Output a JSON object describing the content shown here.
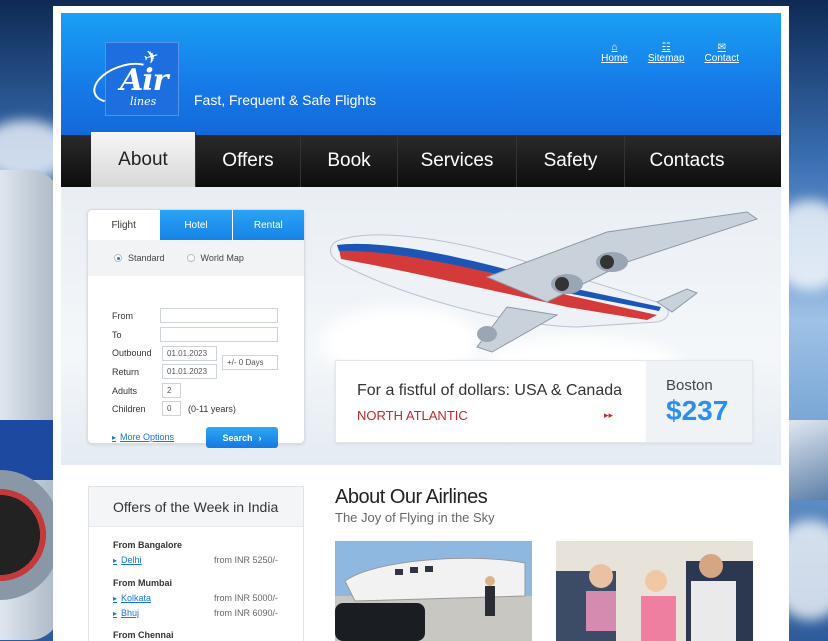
{
  "logo": {
    "text": "Air",
    "subtext": "lines"
  },
  "tagline": "Fast, Frequent & Safe Flights",
  "toplinks": [
    {
      "label": "Home",
      "icon": "home-icon"
    },
    {
      "label": "Sitemap",
      "icon": "sitemap-icon"
    },
    {
      "label": "Contact",
      "icon": "mail-icon"
    }
  ],
  "nav": [
    "About",
    "Offers",
    "Book",
    "Services",
    "Safety",
    "Contacts"
  ],
  "nav_active": "About",
  "booking": {
    "tabs": [
      "Flight",
      "Hotel",
      "Rental"
    ],
    "radio_standard": "Standard",
    "radio_worldmap": "World Map",
    "from_label": "From",
    "from_value": "",
    "to_label": "To",
    "to_value": "",
    "outbound_label": "Outbound",
    "outbound_value": "01.01.2023",
    "return_label": "Return",
    "return_value": "01.01.2023",
    "days_value": "+/- 0 Days",
    "adults_label": "Adults",
    "adults_value": "2",
    "children_label": "Children",
    "children_value": "0",
    "children_note": "(0-11 years)",
    "more_options": "More Options",
    "search": "Search"
  },
  "promo": {
    "title": "For a fistful of dollars: USA & Canada",
    "subtitle": "NORTH ATLANTIC",
    "city": "Boston",
    "price": "$237"
  },
  "offers": {
    "title": "Offers of the Week in India",
    "from_bangalore": "From Bangalore",
    "delhi": "Delhi",
    "delhi_price": "from INR 5250/-",
    "from_mumbai": "From Mumbai",
    "kolkata": "Kolkata",
    "kolkata_price": "from INR 5000/-",
    "bhuj": "Bhuj",
    "bhuj_price": "from INR 6090/-",
    "from_chennai": "From Chennai"
  },
  "about": {
    "title": "About Our Airlines",
    "subtitle": "The Joy of Flying in the Sky"
  },
  "colors": {
    "brand_blue": "#1578e6",
    "accent_red": "#c62828",
    "nav_dark": "#111111"
  }
}
